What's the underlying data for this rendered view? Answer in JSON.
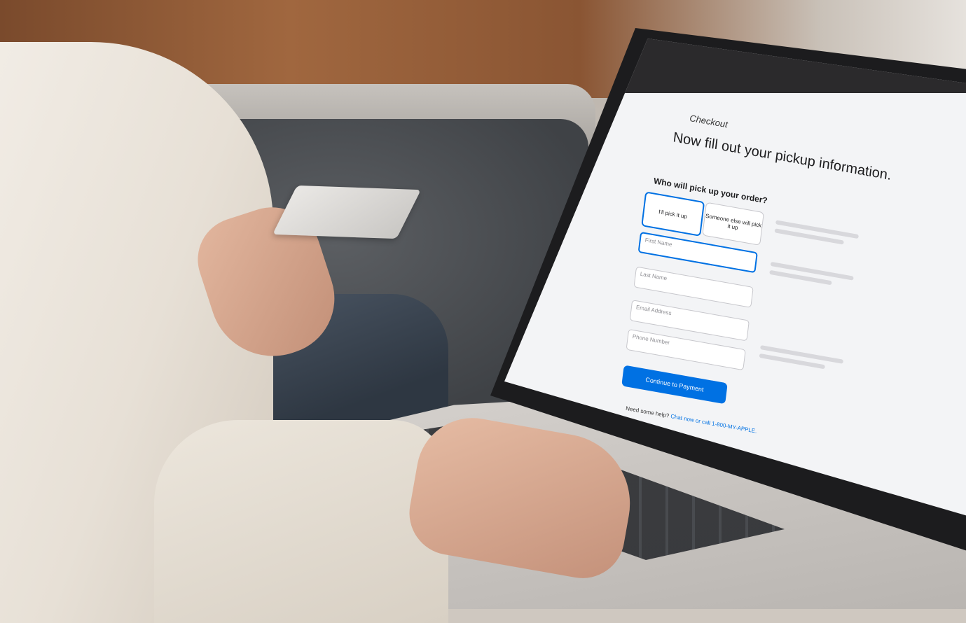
{
  "checkout": {
    "title": "Checkout",
    "headline": "Now fill out your pickup information.",
    "question": "Who will pick up your order?",
    "option_self": "I'll pick it up",
    "option_other": "Someone else will pick it up",
    "first_name_label": "First Name",
    "last_name_placeholder": "Last Name",
    "email_placeholder": "Email Address",
    "phone_placeholder": "Phone Number",
    "continue_button": "Continue to Payment",
    "help_text": "Need some help?",
    "help_link": "Chat now or call 1-800-MY-APPLE."
  },
  "colors": {
    "accent": "#0071e3",
    "screen_bg": "#f3f4f6",
    "browser_bar": "#2b2a2c"
  }
}
